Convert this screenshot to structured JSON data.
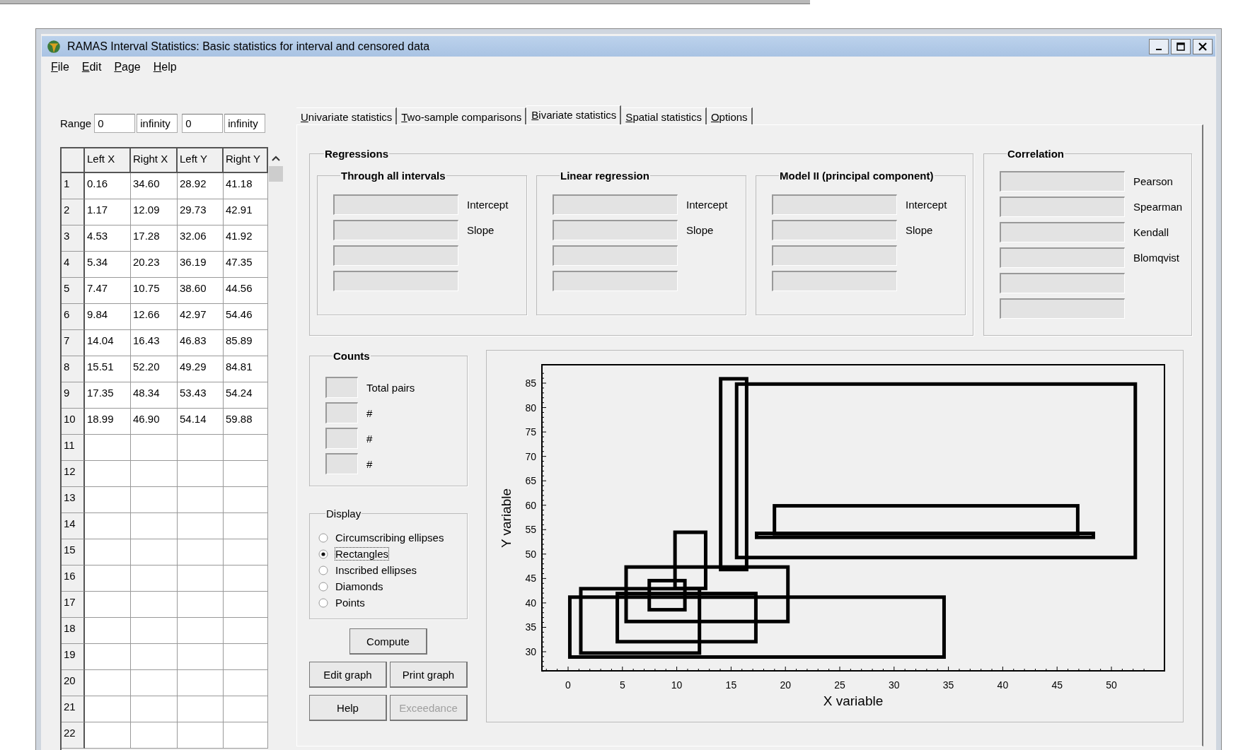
{
  "window": {
    "title": "RAMAS Interval Statistics:  Basic statistics for interval and censored data"
  },
  "menu": [
    "File",
    "Edit",
    "Page",
    "Help"
  ],
  "range": {
    "label": "Range",
    "fields": [
      "0",
      "infinity",
      "0",
      "infinity"
    ]
  },
  "table": {
    "columns": [
      "Left X",
      "Right X",
      "Left Y",
      "Right Y"
    ],
    "rows": [
      {
        "number": "1",
        "cells": [
          "0.16",
          "34.60",
          "28.92",
          "41.18"
        ]
      },
      {
        "number": "2",
        "cells": [
          "1.17",
          "12.09",
          "29.73",
          "42.91"
        ]
      },
      {
        "number": "3",
        "cells": [
          "4.53",
          "17.28",
          "32.06",
          "41.92"
        ]
      },
      {
        "number": "4",
        "cells": [
          "5.34",
          "20.23",
          "36.19",
          "47.35"
        ]
      },
      {
        "number": "5",
        "cells": [
          "7.47",
          "10.75",
          "38.60",
          "44.56"
        ]
      },
      {
        "number": "6",
        "cells": [
          "9.84",
          "12.66",
          "42.97",
          "54.46"
        ]
      },
      {
        "number": "7",
        "cells": [
          "14.04",
          "16.43",
          "46.83",
          "85.89"
        ]
      },
      {
        "number": "8",
        "cells": [
          "15.51",
          "52.20",
          "49.29",
          "84.81"
        ]
      },
      {
        "number": "9",
        "cells": [
          "17.35",
          "48.34",
          "53.43",
          "54.24"
        ]
      },
      {
        "number": "10",
        "cells": [
          "18.99",
          "46.90",
          "54.14",
          "59.88"
        ]
      },
      {
        "number": "11",
        "cells": []
      },
      {
        "number": "12",
        "cells": []
      },
      {
        "number": "13",
        "cells": []
      },
      {
        "number": "14",
        "cells": []
      },
      {
        "number": "15",
        "cells": []
      },
      {
        "number": "16",
        "cells": []
      },
      {
        "number": "17",
        "cells": []
      },
      {
        "number": "18",
        "cells": []
      },
      {
        "number": "19",
        "cells": []
      },
      {
        "number": "20",
        "cells": []
      },
      {
        "number": "21",
        "cells": []
      },
      {
        "number": "22",
        "cells": []
      }
    ]
  },
  "tabs": [
    {
      "label": "Univariate statistics",
      "selected": false
    },
    {
      "label": "Two-sample comparisons",
      "selected": false
    },
    {
      "label": "Bivariate statistics",
      "selected": true
    },
    {
      "label": "Spatial statistics",
      "selected": false
    },
    {
      "label": "Options",
      "selected": false
    }
  ],
  "regressions": {
    "title": "Regressions",
    "groups": [
      {
        "title": "Through all intervals",
        "rows": [
          {
            "kind": "labeled",
            "label": "Intercept"
          },
          {
            "kind": "labeled",
            "label": "Slope"
          },
          {
            "kind": "blank"
          },
          {
            "kind": "blank"
          }
        ]
      },
      {
        "title": "Linear regression",
        "rows": [
          {
            "kind": "labeled",
            "label": "Intercept"
          },
          {
            "kind": "labeled",
            "label": "Slope"
          },
          {
            "kind": "blank"
          },
          {
            "kind": "blank"
          }
        ]
      },
      {
        "title": "Model II (principal component)",
        "rows": [
          {
            "kind": "labeled",
            "label": "Intercept"
          },
          {
            "kind": "labeled",
            "label": "Slope"
          },
          {
            "kind": "blank"
          },
          {
            "kind": "blank"
          }
        ]
      }
    ]
  },
  "correlation": {
    "title": "Correlation",
    "rows": [
      {
        "kind": "labeled",
        "label": "Pearson"
      },
      {
        "kind": "labeled",
        "label": "Spearman"
      },
      {
        "kind": "labeled",
        "label": "Kendall"
      },
      {
        "kind": "labeled",
        "label": "Blomqvist"
      },
      {
        "kind": "blank"
      },
      {
        "kind": "blank"
      }
    ]
  },
  "counts": {
    "title": "Counts",
    "rows": [
      {
        "label": "Total pairs"
      },
      {
        "label": "#"
      },
      {
        "label": "#"
      },
      {
        "label": "#"
      }
    ]
  },
  "display": {
    "title": "Display",
    "options": [
      {
        "label": "Circumscribing ellipses",
        "selected": false
      },
      {
        "label": "Rectangles",
        "selected": true
      },
      {
        "label": "Inscribed ellipses",
        "selected": false
      },
      {
        "label": "Diamonds",
        "selected": false
      },
      {
        "label": "Points",
        "selected": false
      }
    ]
  },
  "buttons": [
    {
      "label": "Compute",
      "disabled": false
    },
    {
      "label": "Edit graph",
      "disabled": false
    },
    {
      "label": "Print graph",
      "disabled": false
    },
    {
      "label": "Help",
      "disabled": false
    },
    {
      "label": "Exceedance",
      "disabled": true
    }
  ],
  "graph": {
    "xlabel": "X variable",
    "ylabel": "Y variable",
    "xticks": [
      "0",
      "5",
      "10",
      "15",
      "20",
      "25",
      "30",
      "35",
      "40",
      "45",
      "50"
    ],
    "yticks": [
      "85",
      "80",
      "75",
      "70",
      "65",
      "60",
      "55",
      "50",
      "45",
      "40",
      "35",
      "30"
    ]
  }
}
